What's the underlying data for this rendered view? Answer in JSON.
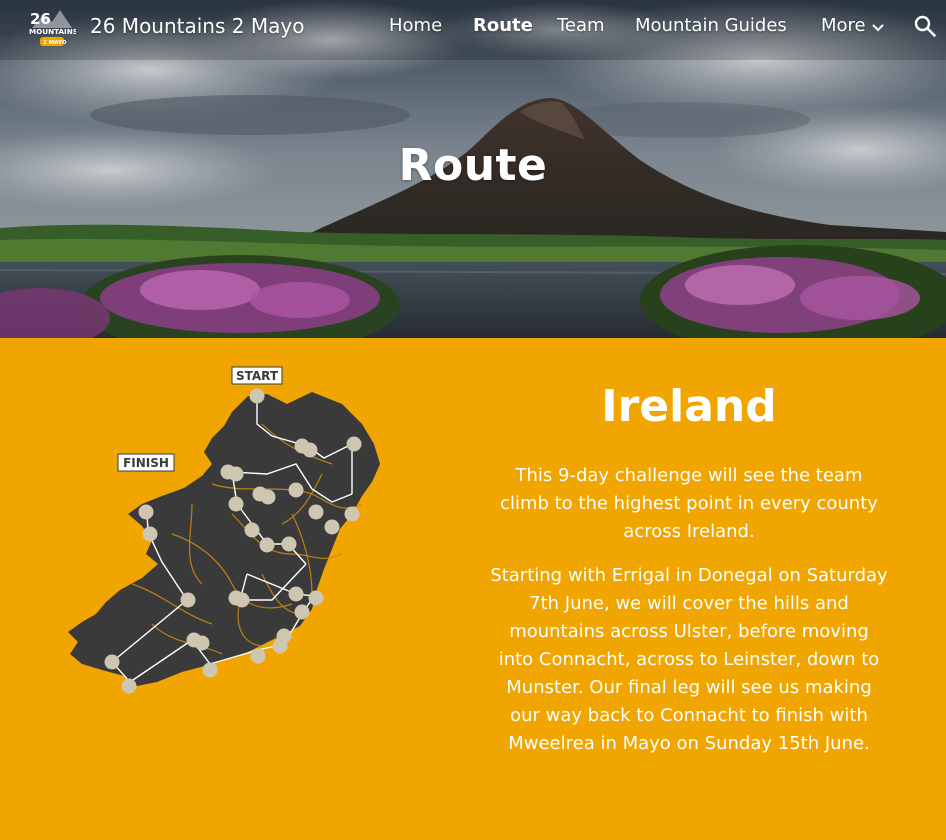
{
  "header": {
    "logo": {
      "line1": "26",
      "line2": "MOUNTAINS",
      "line3": "2 MAYO"
    },
    "site_title": "26 Mountains 2 Mayo",
    "nav": [
      {
        "label": "Home",
        "active": false
      },
      {
        "label": "Route",
        "active": true
      },
      {
        "label": "Team",
        "active": false
      },
      {
        "label": "Mountain Guides",
        "active": false
      }
    ],
    "more_label": "More",
    "icons": {
      "more": "chevron-down-icon",
      "search": "search-icon"
    }
  },
  "hero": {
    "title": "Route"
  },
  "main": {
    "section_title": "Ireland",
    "paragraphs": [
      "This 9-day challenge will see the team climb to the highest point in every county across Ireland.",
      "Starting with Errigal in Donegal on Saturday 7th June, we will cover the hills and mountains across Ulster, before moving into Connacht, across to Leinster, down to Munster. Our final leg will see us making our way back to Connacht to finish with Mweelrea in Mayo on Sunday 15th June."
    ],
    "map": {
      "start_label": "START",
      "finish_label": "FINISH"
    }
  },
  "colors": {
    "accent": "#f0a500",
    "map_land": "#3a3a3a",
    "map_borders": "#c98a12",
    "map_points": "#cfc6b2"
  }
}
